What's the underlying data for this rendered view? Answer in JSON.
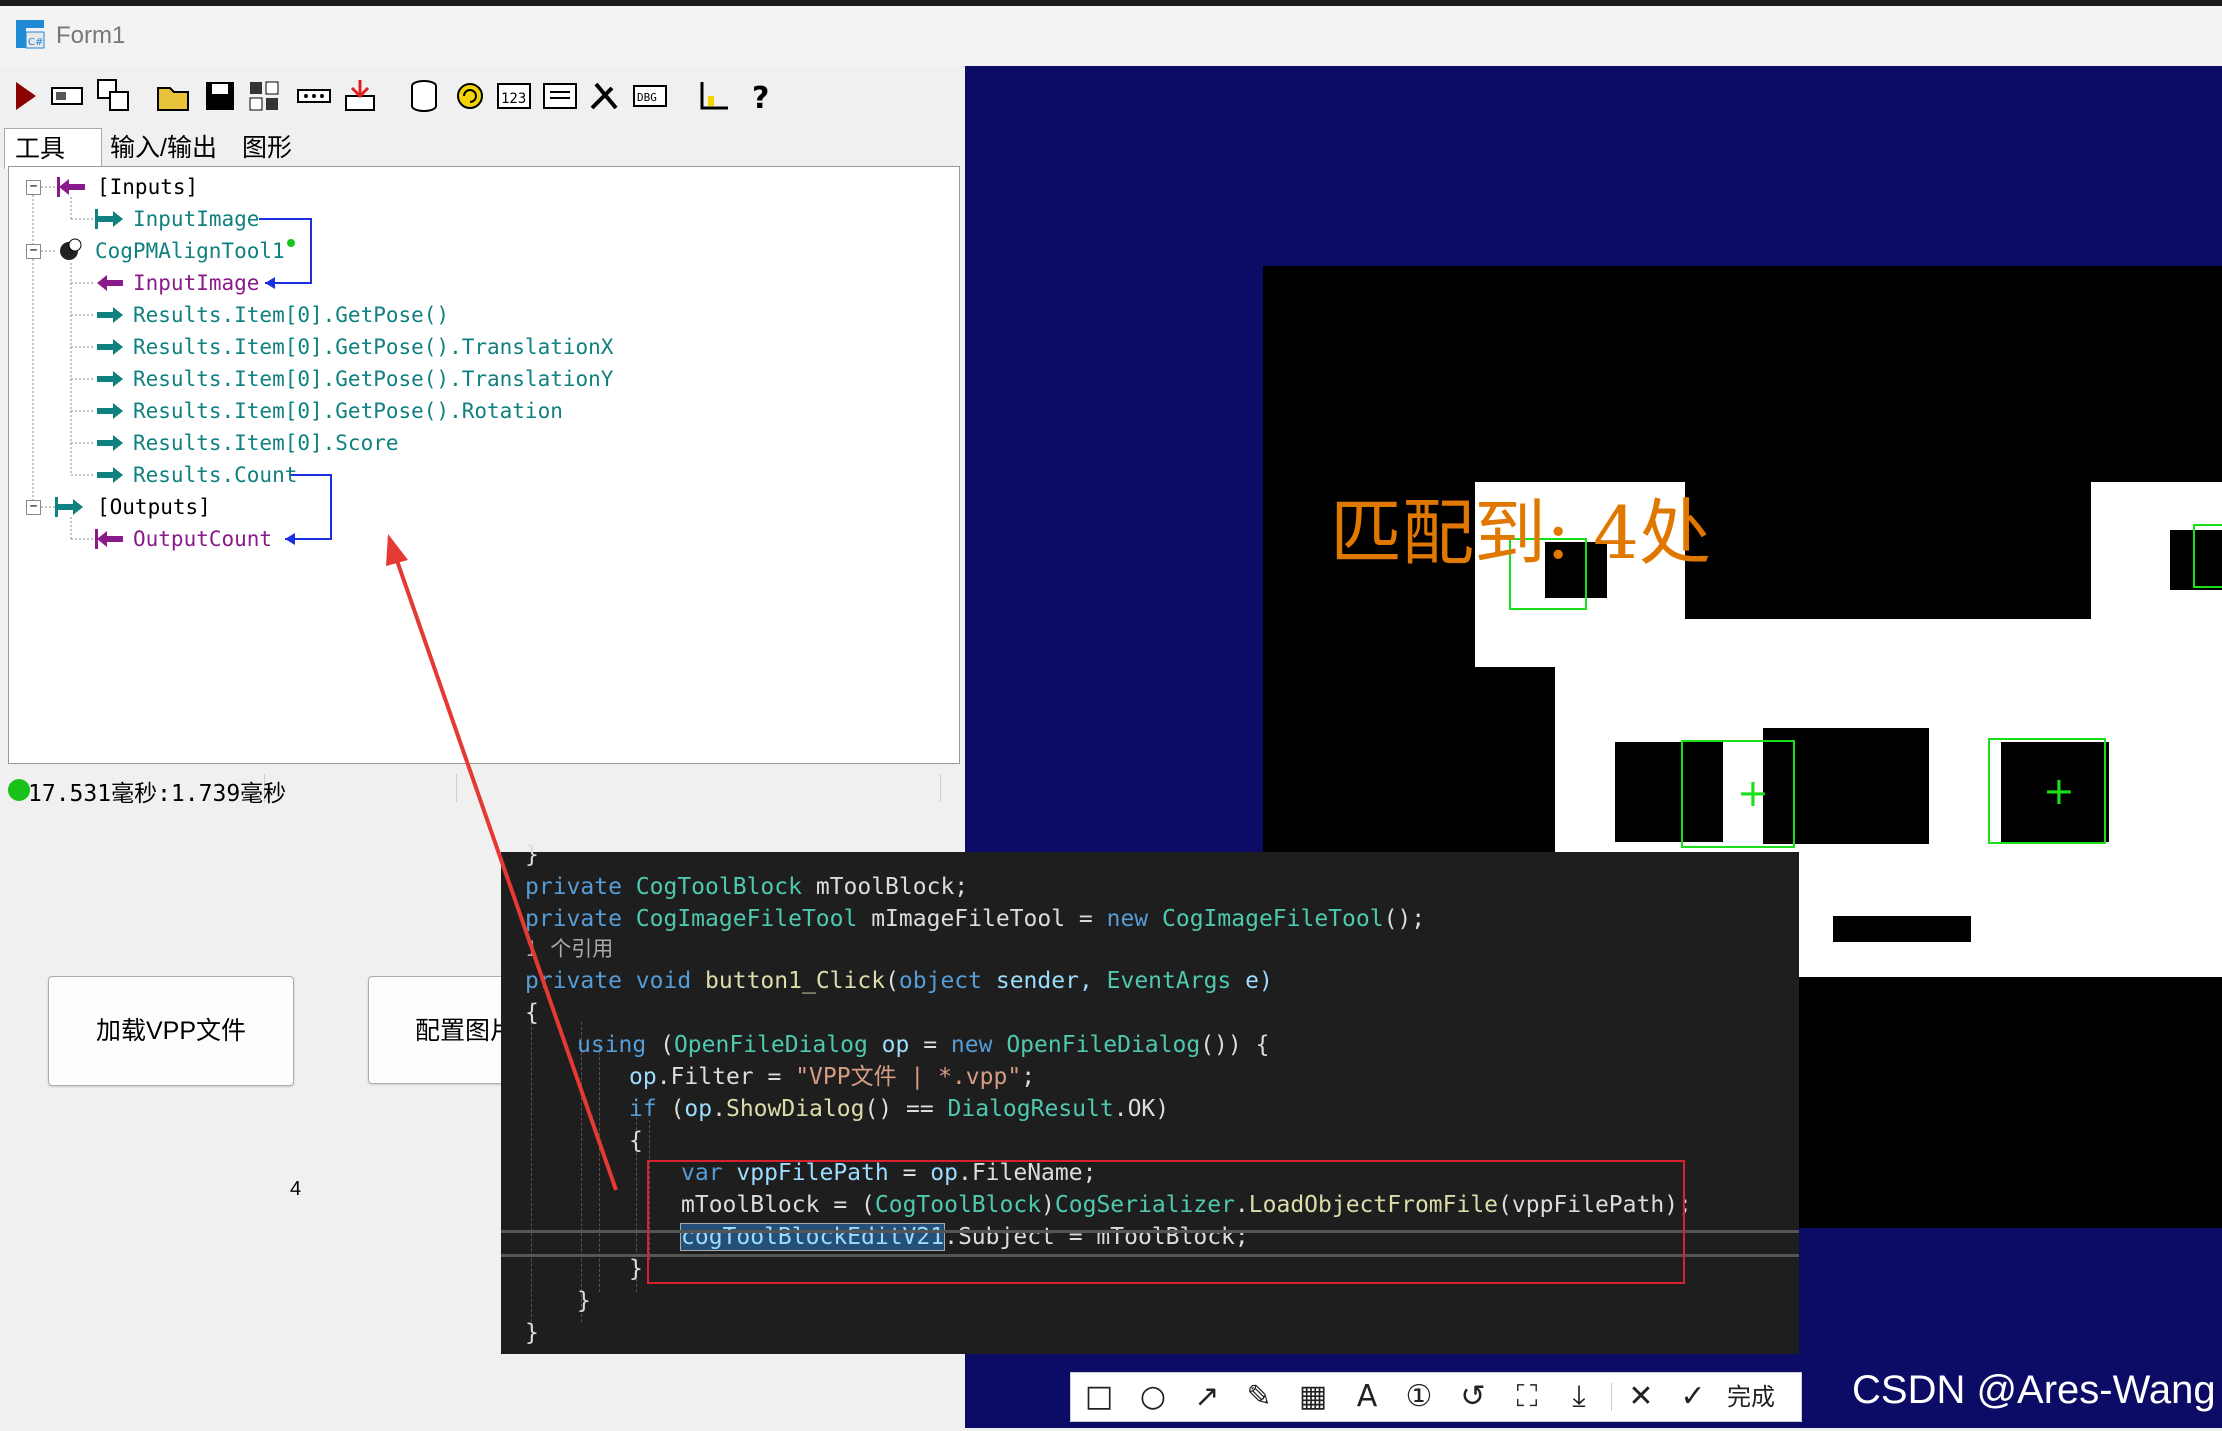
{
  "window": {
    "title": "Form1"
  },
  "tabs": [
    {
      "label": "工具"
    },
    {
      "label": "输入/输出"
    },
    {
      "label": "图形"
    }
  ],
  "tree": {
    "inputs": "[Inputs]",
    "input_image": "InputImage",
    "tool": "CogPMAlignTool1",
    "tool_input": "InputImage",
    "outputs_list": [
      "Results.Item[0].GetPose()",
      "Results.Item[0].GetPose().TranslationX",
      "Results.Item[0].GetPose().TranslationY",
      "Results.Item[0].GetPose().Rotation",
      "Results.Item[0].Score",
      "Results.Count"
    ],
    "outputs": "[Outputs]",
    "output_count": "OutputCount"
  },
  "status": {
    "text": "17.531毫秒:1.739毫秒",
    "dot_color": "#19c219"
  },
  "buttons": {
    "load_vpp": "加载VPP文件",
    "config_image": "配置图片"
  },
  "count_value": "4",
  "display": {
    "match_text": "匹配到: 4处",
    "bg_color": "#0c0c66",
    "match_color": "#e07800"
  },
  "code": {
    "l0": "}",
    "l1a": "private",
    "l1b": "CogToolBlock",
    "l1c": " mToolBlock;",
    "l2a": "private",
    "l2b": "CogImageFileTool",
    "l2c": " mImageFileTool = ",
    "l2d": "new",
    "l2e": "CogImageFileTool",
    "l2f": "();",
    "l3": "1 个引用",
    "l4a": "private",
    "l4b": "void",
    "l4c": "button1_Click",
    "l4d": "(",
    "l4e": "object",
    "l4f": " sender, ",
    "l4g": "EventArgs",
    "l4h": " e)",
    "l5": "{",
    "l6a": "using",
    "l6b": " (",
    "l6c": "OpenFileDialog",
    "l6d": " op",
    "l6e": " = ",
    "l6f": "new",
    "l6g": "OpenFileDialog",
    "l6h": "()) {",
    "l7a": "op",
    "l7b": ".Filter = ",
    "l7c": "\"VPP文件 | *.vpp\"",
    "l7d": ";",
    "l8a": "if",
    "l8b": " (",
    "l8c": "op",
    "l8d": ".",
    "l8e": "ShowDialog",
    "l8f": "() == ",
    "l8g": "DialogResult",
    "l8h": ".OK)",
    "l9": "{",
    "l10a": "var",
    "l10b": " vppFilePath",
    "l10c": " = ",
    "l10d": "op",
    "l10e": ".FileName;",
    "l11a": "mToolBlock = (",
    "l11b": "CogToolBlock",
    "l11c": ")",
    "l11d": "CogSerializer",
    "l11e": ".",
    "l11f": "LoadObjectFromFile",
    "l11g": "(vppFilePath);",
    "l12a": "cogToolBlockEditV21",
    "l12b": ".Subject = mToolBlock;",
    "l13": "}",
    "l14": "}",
    "l15": "}"
  },
  "annotation": {
    "done_label": "完成",
    "icons": [
      "rect-tool-icon",
      "ellipse-tool-icon",
      "arrow-tool-icon",
      "pen-tool-icon",
      "mosaic-tool-icon",
      "text-tool-icon",
      "number-tool-icon",
      "undo-icon",
      "ocr-icon",
      "download-icon",
      "close-icon",
      "confirm-icon"
    ]
  },
  "watermark": "CSDN @Ares-Wang"
}
